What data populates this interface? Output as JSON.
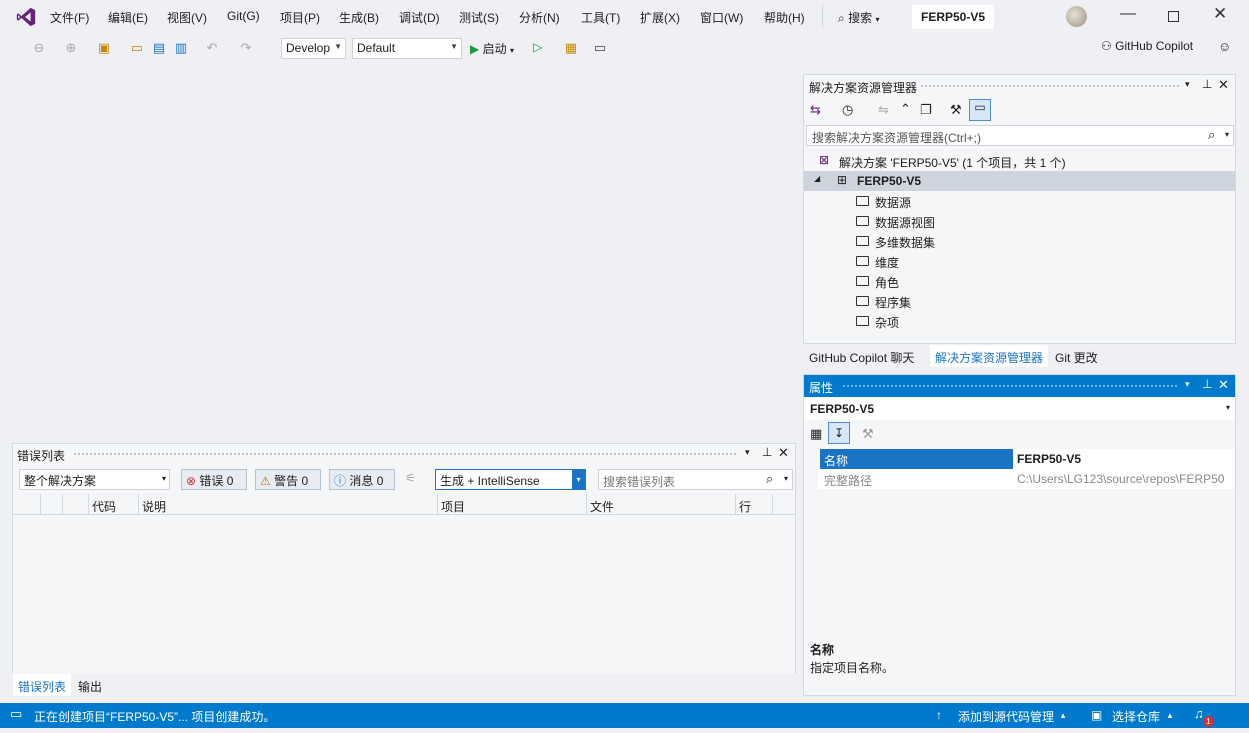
{
  "menu": [
    "文件(F)",
    "编辑(E)",
    "视图(V)",
    "Git(G)",
    "项目(P)",
    "生成(B)",
    "调试(D)",
    "测试(S)",
    "分析(N)",
    "工具(T)",
    "扩展(X)",
    "窗口(W)",
    "帮助(H)"
  ],
  "search_label": "搜索",
  "project_badge": "FERP50-V5",
  "toolbar": {
    "config_combo": "Develop",
    "platform_combo": "Default",
    "start_label": "启动",
    "copilot_label": "GitHub Copilot"
  },
  "solution_explorer": {
    "title": "解决方案资源管理器",
    "search_placeholder": "搜索解决方案资源管理器(Ctrl+;)",
    "solution_line": "解决方案 'FERP50-V5' (1 个项目，共 1 个)",
    "project": "FERP50-V5",
    "folders": [
      "数据源",
      "数据源视图",
      "多维数据集",
      "维度",
      "角色",
      "程序集",
      "杂项"
    ],
    "tabs": [
      "GitHub Copilot 聊天",
      "解决方案资源管理器",
      "Git 更改"
    ]
  },
  "properties": {
    "title": "属性",
    "object": "FERP50-V5",
    "rows": [
      {
        "name": "名称",
        "value": "FERP50-V5"
      },
      {
        "name": "完整路径",
        "value": "C:\\Users\\LG123\\source\\repos\\FERP50"
      }
    ],
    "desc_title": "名称",
    "desc_text": "指定项目名称。"
  },
  "error_list": {
    "title": "错误列表",
    "scope": "整个解决方案",
    "errors": "错误 0",
    "warnings": "警告 0",
    "messages": "消息 0",
    "build_filter": "生成 + IntelliSense",
    "search_placeholder": "搜索错误列表",
    "columns": [
      "代码",
      "说明",
      "项目",
      "文件",
      "行"
    ],
    "tabs": [
      "错误列表",
      "输出"
    ]
  },
  "status": {
    "message": "正在创建项目“FERP50-V5”... 项目创建成功。",
    "source_control": "添加到源代码管理",
    "repo": "选择仓库",
    "notifications": "1"
  },
  "colors": {
    "accent": "#007acc",
    "vs_purple": "#68217a",
    "error": "#d13438",
    "warning": "#e8a317",
    "info": "#1a73c5"
  }
}
